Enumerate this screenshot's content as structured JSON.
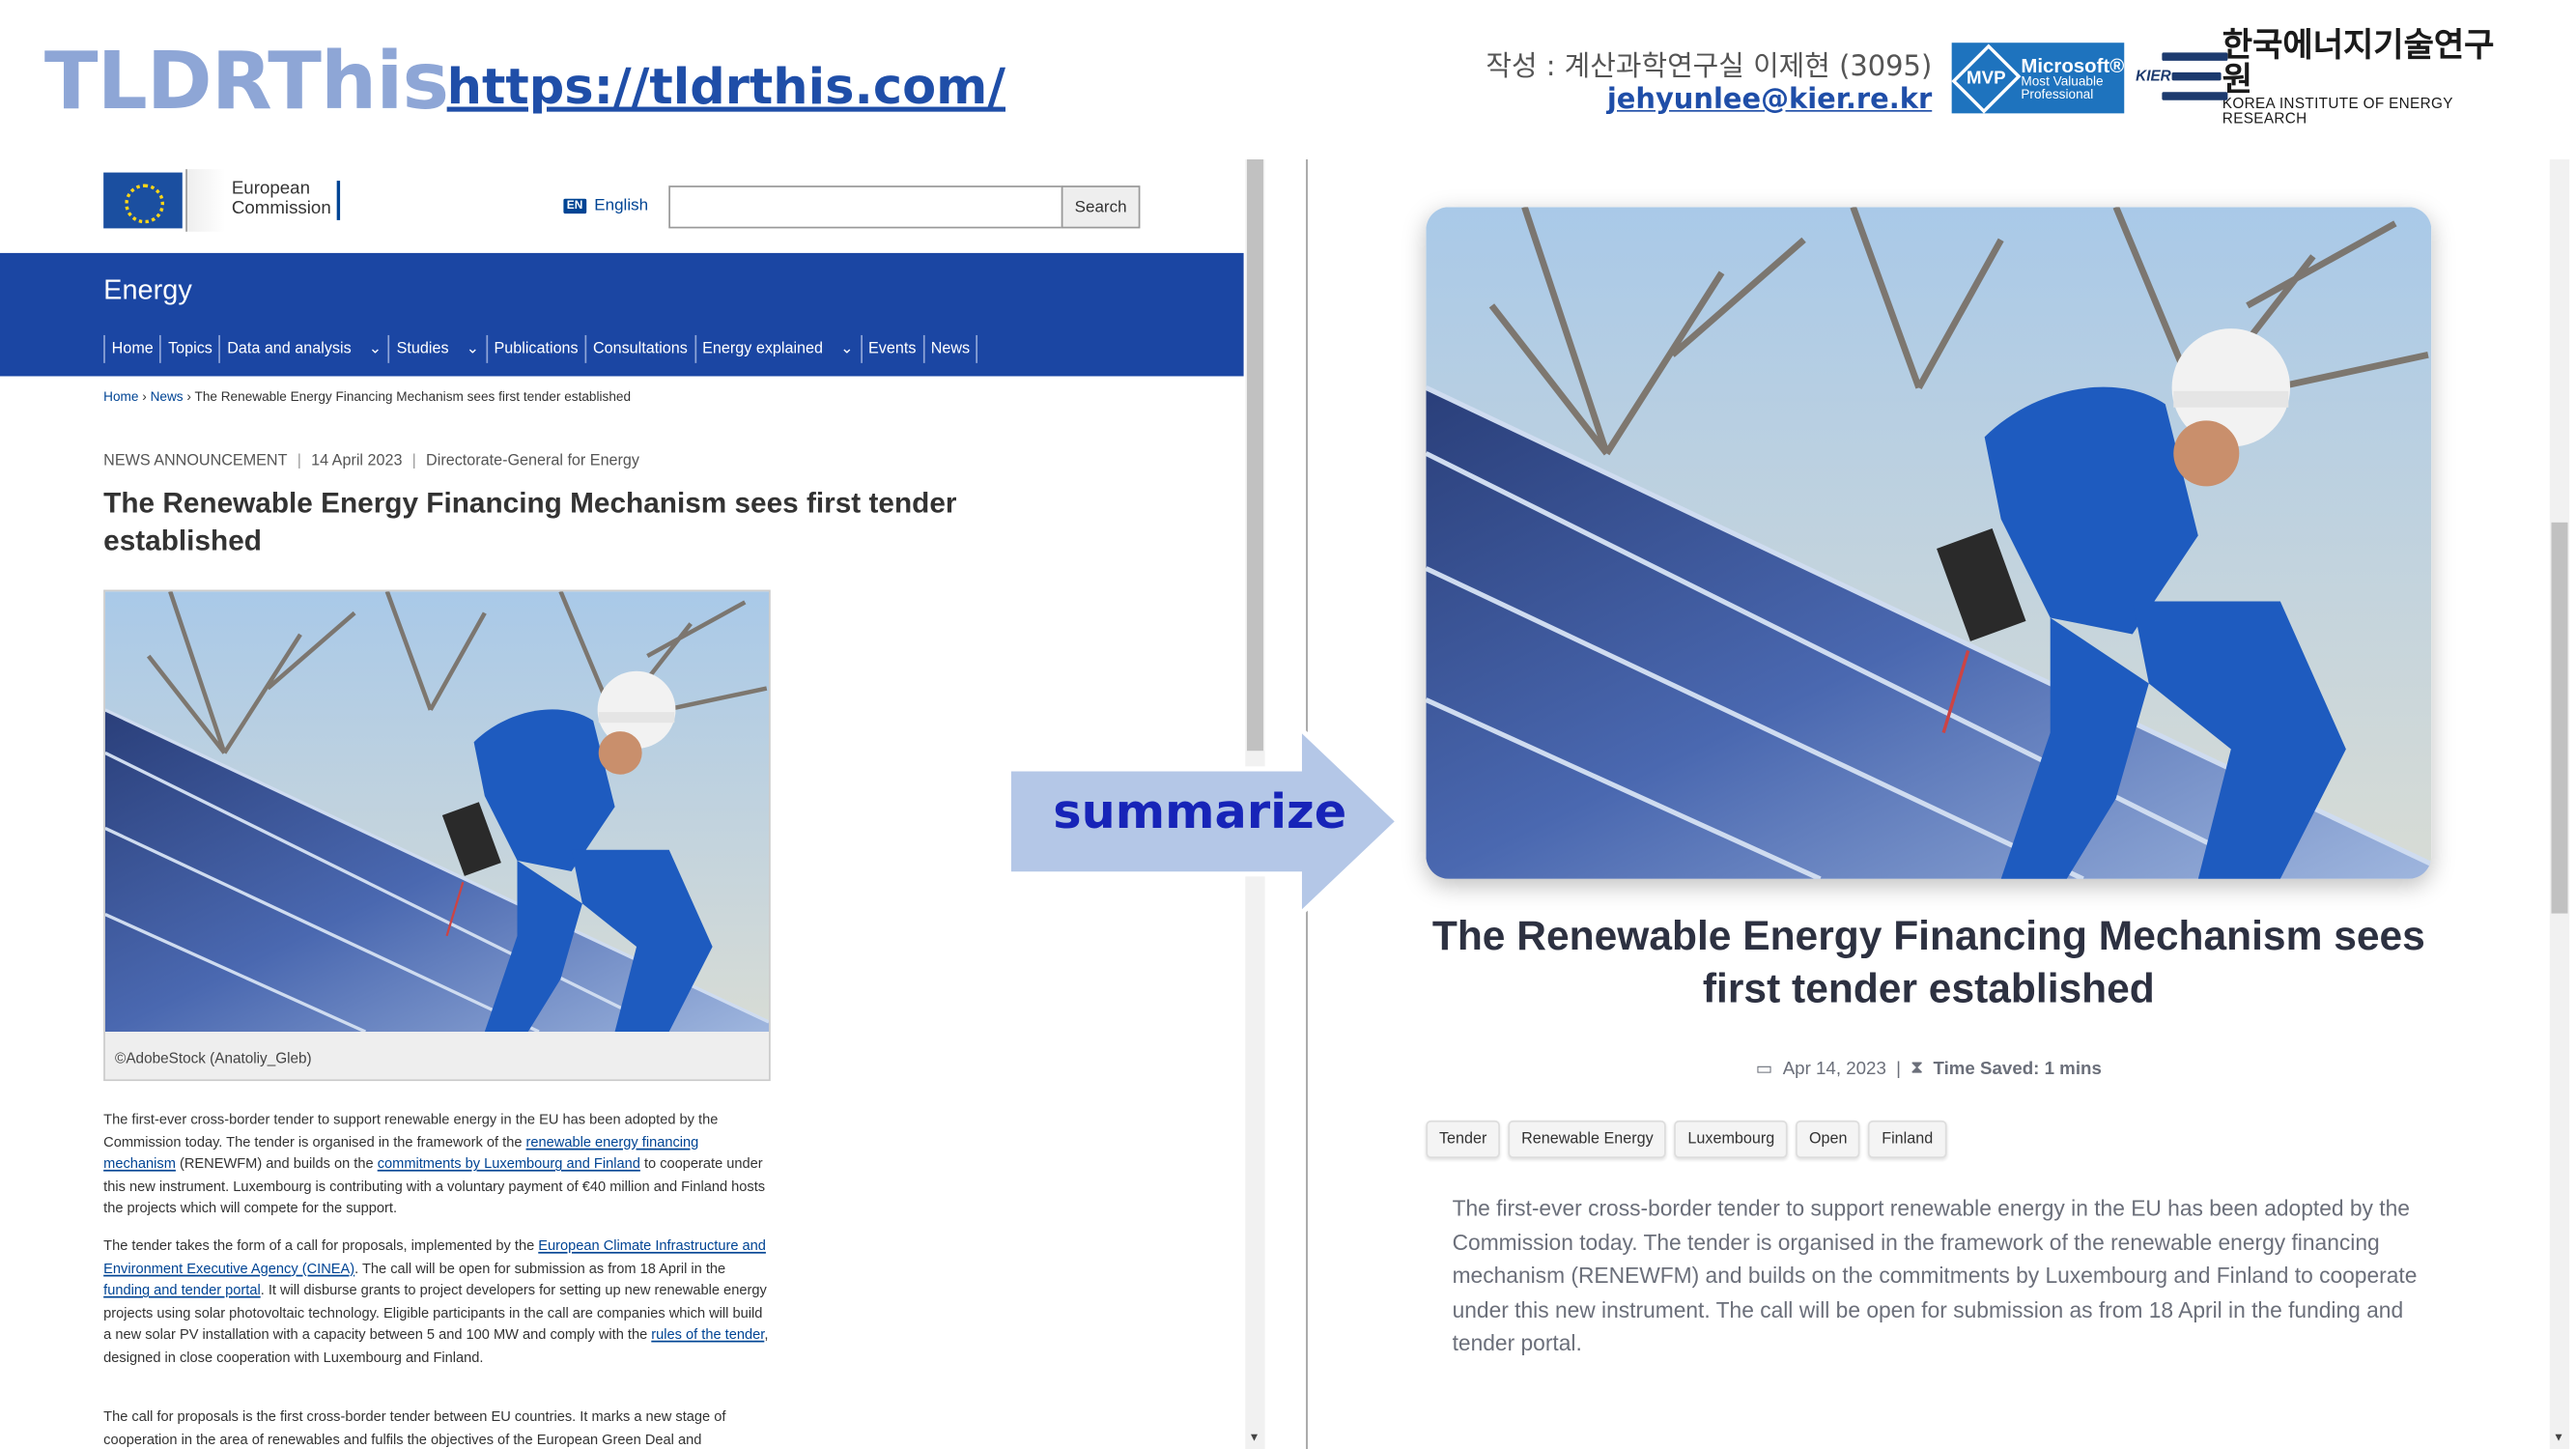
{
  "slide": {
    "title": "TLDRThis",
    "url": "https://tldrthis.com/",
    "author_line": "작성 : 계산과학연구실 이제현 (3095)",
    "author_email": "jehyunlee@kier.re.kr",
    "mvp": {
      "mark": "MVP",
      "line1": "Microsoft®",
      "line2": "Most Valuable",
      "line3": "Professional"
    },
    "kier": {
      "mark": "KIER",
      "ko": "한국에너지기술연구원",
      "en": "KOREA INSTITUTE OF ENERGY RESEARCH"
    },
    "arrow_label": "summarize"
  },
  "left_page": {
    "logo_text": [
      "European",
      "Commission"
    ],
    "language": {
      "code": "EN",
      "label": "English"
    },
    "search": {
      "placeholder": "",
      "button": "Search"
    },
    "site_title": "Energy",
    "menu": [
      "Home",
      "Topics",
      "Data and analysis",
      "Studies",
      "Publications",
      "Consultations",
      "Energy explained",
      "Events",
      "News"
    ],
    "menu_has_dropdown": [
      "Data and analysis",
      "Studies",
      "Energy explained"
    ],
    "breadcrumb": [
      "Home",
      "News",
      "The Renewable Energy Financing Mechanism sees first tender established"
    ],
    "meta": {
      "type": "NEWS ANNOUNCEMENT",
      "date": "14 April 2023",
      "source": "Directorate-General for Energy"
    },
    "title": "The Renewable Energy Financing Mechanism sees first tender established",
    "photo_caption": "©AdobeStock (Anatoliy_Gleb)",
    "paragraphs": [
      {
        "segments": [
          {
            "text": "The first-ever cross-border tender to support renewable energy in the EU has been adopted by the Commission today. The tender is organised in the framework of the "
          },
          {
            "text": "renewable energy financing mechanism",
            "link": true
          },
          {
            "text": " (RENEWFM) and builds on the "
          },
          {
            "text": "commitments by Luxembourg and Finland",
            "link": true
          },
          {
            "text": " to cooperate under this new instrument. Luxembourg is contributing with a voluntary payment of €40 million and Finland hosts the projects which will compete for the support."
          }
        ]
      },
      {
        "segments": [
          {
            "text": "The tender takes the form of a call for proposals, implemented by the "
          },
          {
            "text": "European Climate Infrastructure and Environment Executive Agency (CINEA)",
            "link": true
          },
          {
            "text": ". The call will be open for submission as from 18 April in the "
          },
          {
            "text": "funding and tender portal",
            "link": true
          },
          {
            "text": ". It will disburse grants to project developers for setting up new renewable energy projects using solar photovoltaic technology. Eligible participants in the call are companies which will build a new solar PV installation with a capacity between 5 and 100 MW and comply with the "
          },
          {
            "text": "rules of the tender",
            "link": true
          },
          {
            "text": ", designed in close cooperation with Luxembourg and Finland."
          }
        ]
      },
      {
        "segments": [
          {
            "text": "The call for proposals is the first cross-border tender between EU countries. It marks a new stage of cooperation in the area of renewables and fulfils the objectives of the European Green Deal and"
          }
        ]
      }
    ]
  },
  "right_page": {
    "title": "The Renewable Energy Financing Mechanism sees first tender established",
    "date": "Apr 14, 2023",
    "time_saved": "Time Saved: 1 mins",
    "tags": [
      "Tender",
      "Renewable Energy",
      "Luxembourg",
      "Open",
      "Finland"
    ],
    "summary": "The first-ever cross-border tender to support renewable energy in the EU has been adopted by the Commission today. The tender is organised in the framework of the renewable energy financing mechanism (RENEWFM) and builds on the commitments by Luxembourg and Finland to cooperate under this new instrument. The call will be open for submission as from 18 April in the funding and tender portal."
  },
  "colors": {
    "slide_title": "#8ea6d6",
    "link_blue": "#1f4ea8",
    "ec_blue": "#1b46a3",
    "arrow_fill": "#b4c7e7",
    "arrow_label": "#1724b8"
  },
  "icons": [
    "calendar-icon",
    "hourglass-icon",
    "chevron-down-icon",
    "scroll-down-arrow-icon"
  ]
}
